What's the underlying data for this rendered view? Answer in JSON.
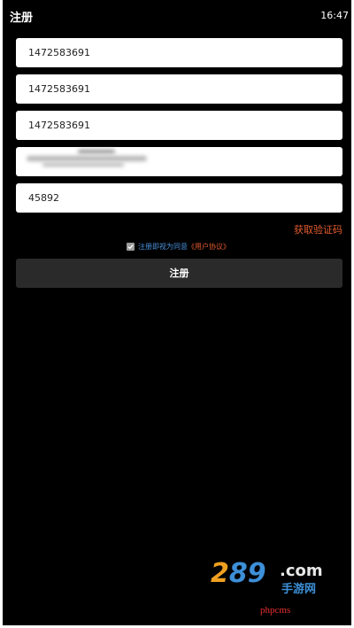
{
  "status_bar": {
    "title": "注册",
    "time": "16:47"
  },
  "form": {
    "fields": [
      {
        "value": "1472583691"
      },
      {
        "value": "1472583691"
      },
      {
        "value": "1472583691"
      },
      {
        "value": ""
      },
      {
        "value": "45892"
      }
    ],
    "get_code_label": "获取验证码",
    "agreement": {
      "checked": true,
      "text": "注册即视为同意",
      "link": "《用户协议》"
    },
    "submit_label": "注册"
  },
  "watermark": {
    "logo_number_a": "2",
    "logo_number_b": "89",
    "logo_domain": ".com",
    "logo_cn": "手游网",
    "site": "phpcms"
  },
  "colors": {
    "background": "#000000",
    "field_bg": "#ffffff",
    "button_bg": "#2a2a2a",
    "accent_orange": "#e35b2f",
    "accent_blue": "#4a90d9"
  }
}
